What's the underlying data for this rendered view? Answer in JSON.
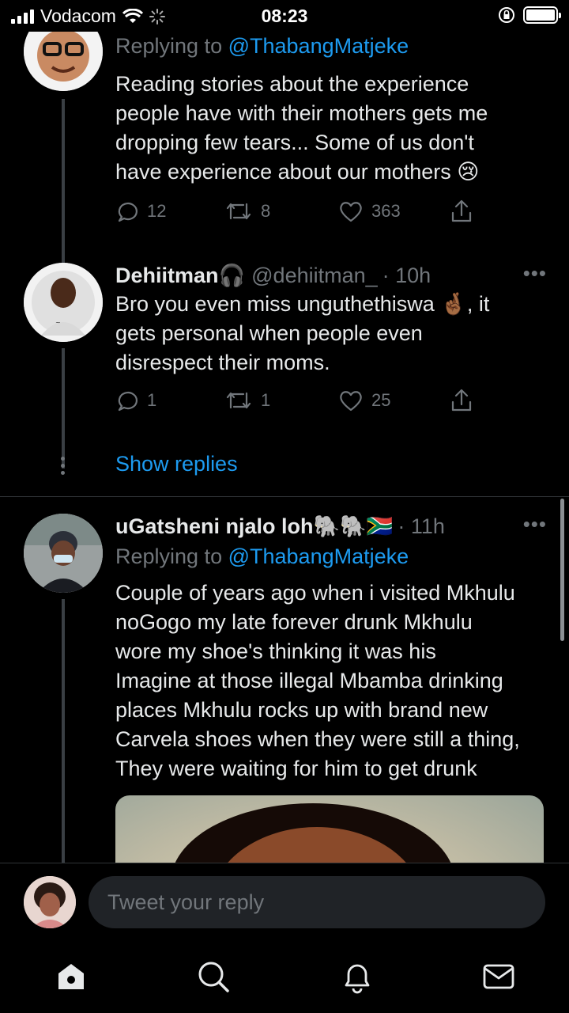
{
  "status_bar": {
    "carrier": "Vodacom",
    "time": "08:23"
  },
  "tweets": [
    {
      "reply_prefix": "Replying to",
      "reply_handle": "@ThabangMatjeke",
      "text": "Reading stories about the experience\npeople have with their mothers gets me\ndropping few tears... Some of us don't\nhave experience about our mothers 😢",
      "replies": "12",
      "retweets": "8",
      "likes": "363"
    },
    {
      "name": "Dehiitman🎧",
      "handle": "@dehiitman_",
      "time": "· 10h",
      "text": "Bro you even miss unguthethiswa 🤞🏾, it\ngets personal when people even\ndisrespect their moms.",
      "replies": "1",
      "retweets": "1",
      "likes": "25"
    },
    {
      "name": "uGatsheni njalo loh🐘🐘🇿🇦",
      "time": "· 11h",
      "reply_prefix": "Replying to",
      "reply_handle": "@ThabangMatjeke",
      "text": "Couple of years ago when i visited Mkhulu\nnoGogo my late forever drunk Mkhulu\nwore my shoe's thinking it was his\nImagine at  those illegal Mbamba drinking\nplaces  Mkhulu rocks up with brand new\nCarvela shoes when they were still a thing,\nThey were waiting for him to get drunk"
    }
  ],
  "show_replies": "Show replies",
  "more_label": "•••",
  "composer": {
    "placeholder": "Tweet your reply"
  },
  "tabs": [
    "home-icon",
    "search-icon",
    "notifications-icon",
    "messages-icon"
  ],
  "colors": {
    "accent": "#1d9bf0",
    "muted": "#71767b",
    "background": "#000000"
  }
}
